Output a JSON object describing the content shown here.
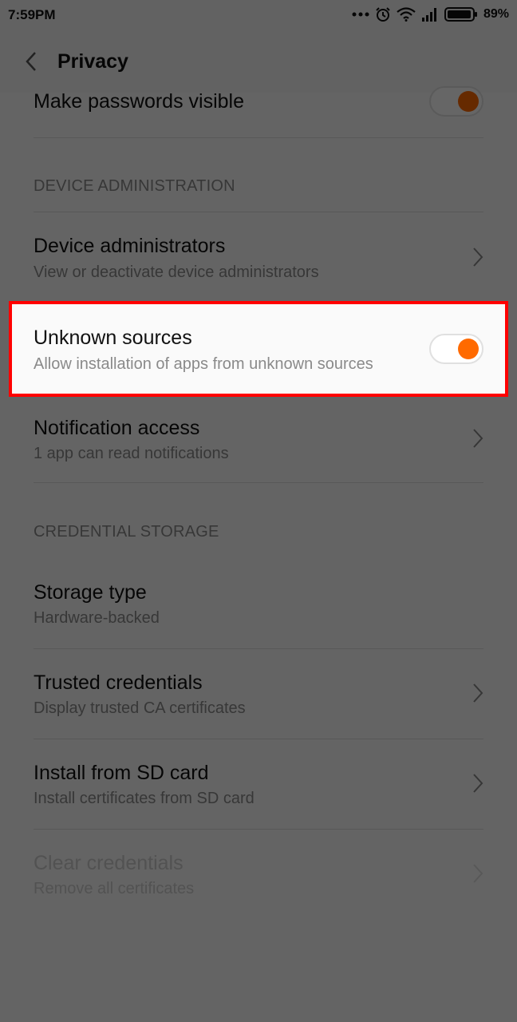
{
  "status_bar": {
    "time": "7:59PM",
    "battery_percent": "89%",
    "icons": [
      "more-dots-icon",
      "alarm-icon",
      "wifi-icon",
      "signal-icon",
      "battery-icon"
    ]
  },
  "header": {
    "title": "Privacy",
    "back_icon": "chevron-left-icon"
  },
  "settings": {
    "make_passwords_visible": {
      "title": "Make passwords visible",
      "enabled": true
    },
    "device_administration": {
      "header": "DEVICE ADMINISTRATION",
      "device_administrators": {
        "title": "Device administrators",
        "subtitle": "View or deactivate device administrators"
      },
      "unknown_sources": {
        "title": "Unknown sources",
        "subtitle": "Allow installation of apps from unknown sources",
        "enabled": true
      },
      "notification_access": {
        "title": "Notification access",
        "subtitle": "1 app can read notifications"
      }
    },
    "credential_storage": {
      "header": "CREDENTIAL STORAGE",
      "storage_type": {
        "title": "Storage type",
        "subtitle": "Hardware-backed"
      },
      "trusted_credentials": {
        "title": "Trusted credentials",
        "subtitle": "Display trusted CA certificates"
      },
      "install_from_sd": {
        "title": "Install from SD card",
        "subtitle": "Install certificates from SD card"
      },
      "clear_credentials": {
        "title": "Clear credentials",
        "subtitle": "Remove all certificates",
        "disabled": true
      }
    }
  },
  "colors": {
    "accent": "#ff6a00",
    "highlight_border": "#ff0000",
    "overlay": "rgba(0,0,0,0.6)"
  }
}
